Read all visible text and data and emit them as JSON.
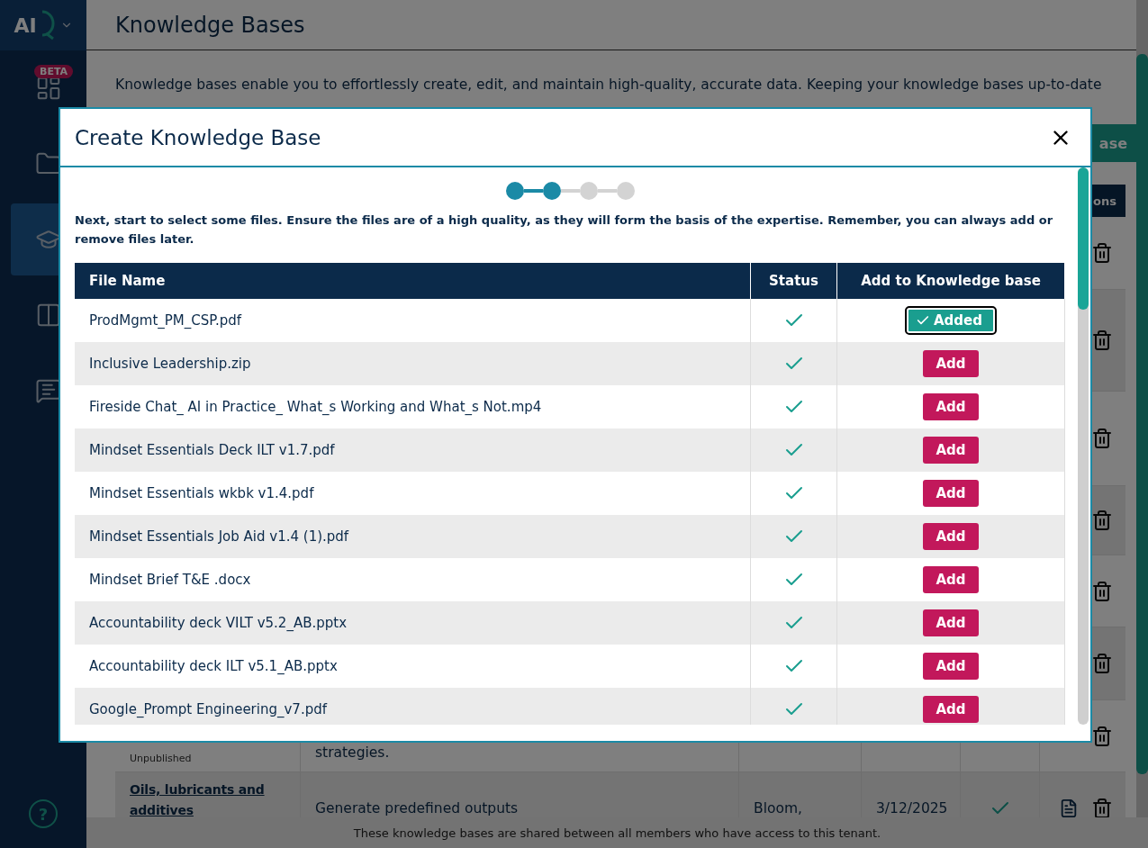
{
  "sidebar": {
    "logo": "AI",
    "items": [
      {
        "badge": "BETA",
        "selected": false
      },
      {
        "selected": false
      },
      {
        "selected": true
      },
      {
        "selected": false
      },
      {
        "selected": false
      }
    ],
    "help": "?"
  },
  "page": {
    "title": "Knowledge Bases",
    "description": "Knowledge bases enable you to effortlessly create, edit, and maintain high-quality, accurate data. Keeping your knowledge bases up-to-date",
    "action_button": "ase",
    "table_last_column": "ons",
    "rows": [
      {
        "status": "Unpublished",
        "description": "strategies."
      },
      {
        "title": "Oils, lubricants and additives",
        "description": "Generate predefined outputs",
        "author": "Bloom,",
        "date": "3/12/2025",
        "document": true,
        "published": true
      }
    ],
    "footer": "These knowledge bases are shared between all members who have access to this tenant."
  },
  "modal": {
    "title": "Create Knowledge Base",
    "steps": [
      {
        "completed": true
      },
      {
        "completed": true
      },
      {
        "completed": false
      },
      {
        "completed": false
      }
    ],
    "instructions": "Next, start to select some files. Ensure the files are of a high quality, as they will form the basis of the expertise. Remember, you can always add or remove files later.",
    "columns": [
      "File Name",
      "Status",
      "Add to Knowledge base"
    ],
    "files": [
      {
        "name": "ProdMgmt_PM_CSP.pdf",
        "ready": true,
        "added": true,
        "button": "Added"
      },
      {
        "name": "Inclusive Leadership.zip",
        "ready": true,
        "added": false,
        "button": "Add"
      },
      {
        "name": "Fireside Chat_ AI in Practice_ What_s Working and What_s Not.mp4",
        "ready": true,
        "added": false,
        "button": "Add"
      },
      {
        "name": "Mindset Essentials Deck ILT v1.7.pdf",
        "ready": true,
        "added": false,
        "button": "Add"
      },
      {
        "name": "Mindset Essentials wkbk v1.4.pdf",
        "ready": true,
        "added": false,
        "button": "Add"
      },
      {
        "name": "Mindset Essentials Job Aid v1.4 (1).pdf",
        "ready": true,
        "added": false,
        "button": "Add"
      },
      {
        "name": "Mindset Brief T&E .docx",
        "ready": true,
        "added": false,
        "button": "Add"
      },
      {
        "name": "Accountability deck VILT v5.2_AB.pptx",
        "ready": true,
        "added": false,
        "button": "Add"
      },
      {
        "name": "Accountability deck ILT v5.1_AB.pptx",
        "ready": true,
        "added": false,
        "button": "Add"
      },
      {
        "name": "Google_Prompt Engineering_v7.pdf",
        "ready": true,
        "added": false,
        "button": "Add"
      }
    ]
  }
}
